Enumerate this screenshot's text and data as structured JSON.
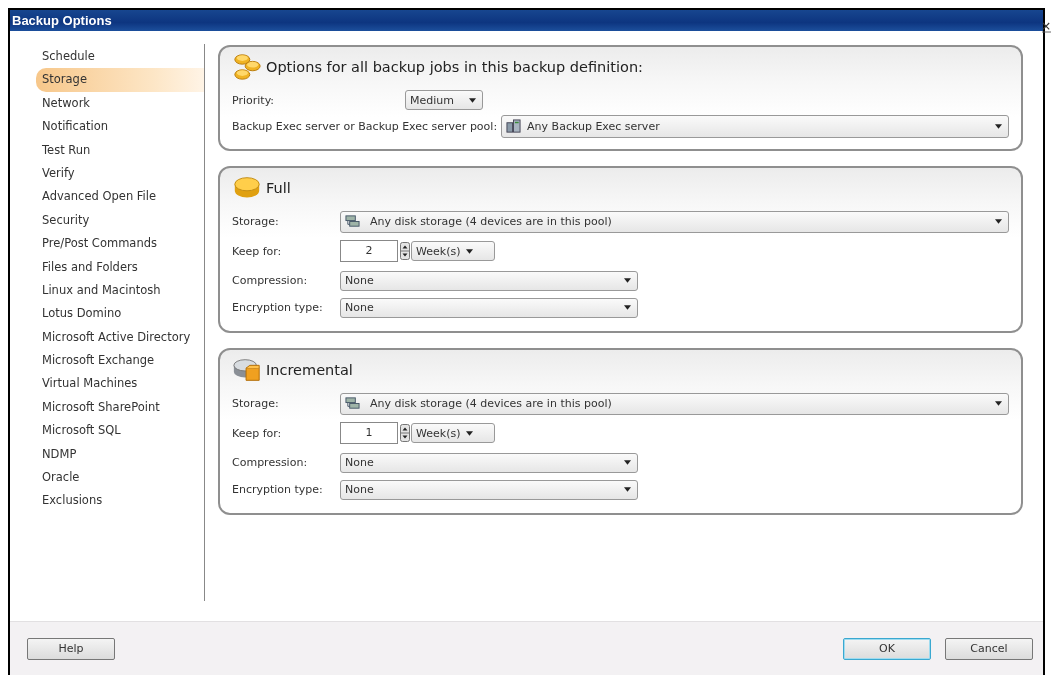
{
  "window": {
    "title": "Backup Options"
  },
  "sidebar": {
    "items": [
      {
        "label": "Schedule",
        "selected": false
      },
      {
        "label": "Storage",
        "selected": true
      },
      {
        "label": "Network",
        "selected": false
      },
      {
        "label": "Notification",
        "selected": false
      },
      {
        "label": "Test Run",
        "selected": false
      },
      {
        "label": "Verify",
        "selected": false
      },
      {
        "label": "Advanced Open File",
        "selected": false
      },
      {
        "label": "Security",
        "selected": false
      },
      {
        "label": "Pre/Post Commands",
        "selected": false
      },
      {
        "label": "Files and Folders",
        "selected": false
      },
      {
        "label": "Linux and Macintosh",
        "selected": false
      },
      {
        "label": "Lotus Domino",
        "selected": false
      },
      {
        "label": "Microsoft Active Directory",
        "selected": false
      },
      {
        "label": "Microsoft Exchange",
        "selected": false
      },
      {
        "label": "Virtual Machines",
        "selected": false
      },
      {
        "label": "Microsoft SharePoint",
        "selected": false
      },
      {
        "label": "Microsoft SQL",
        "selected": false
      },
      {
        "label": "NDMP",
        "selected": false
      },
      {
        "label": "Oracle",
        "selected": false
      },
      {
        "label": "Exclusions",
        "selected": false
      }
    ]
  },
  "general": {
    "title": "Options for all backup jobs in this backup definition:",
    "priority": {
      "label": "Priority:",
      "value": "Medium"
    },
    "server": {
      "label": "Backup Exec server or Backup Exec server pool:",
      "value": "Any Backup Exec server"
    }
  },
  "sections": [
    {
      "kind": "full",
      "title": "Full",
      "storage": {
        "label": "Storage:",
        "value": "Any disk storage (4 devices are in this pool)"
      },
      "keep_for": {
        "label": "Keep for:",
        "value": "2",
        "unit": "Week(s)"
      },
      "compression": {
        "label": "Compression:",
        "value": "None"
      },
      "encryption": {
        "label": "Encryption type:",
        "value": "None"
      }
    },
    {
      "kind": "incremental",
      "title": "Incremental",
      "storage": {
        "label": "Storage:",
        "value": "Any disk storage (4 devices are in this pool)"
      },
      "keep_for": {
        "label": "Keep for:",
        "value": "1",
        "unit": "Week(s)"
      },
      "compression": {
        "label": "Compression:",
        "value": "None"
      },
      "encryption": {
        "label": "Encryption type:",
        "value": "None"
      }
    }
  ],
  "buttons": [
    {
      "label": "Help",
      "focused": false
    },
    {
      "label": "OK",
      "focused": true
    },
    {
      "label": "Cancel",
      "focused": false
    }
  ]
}
